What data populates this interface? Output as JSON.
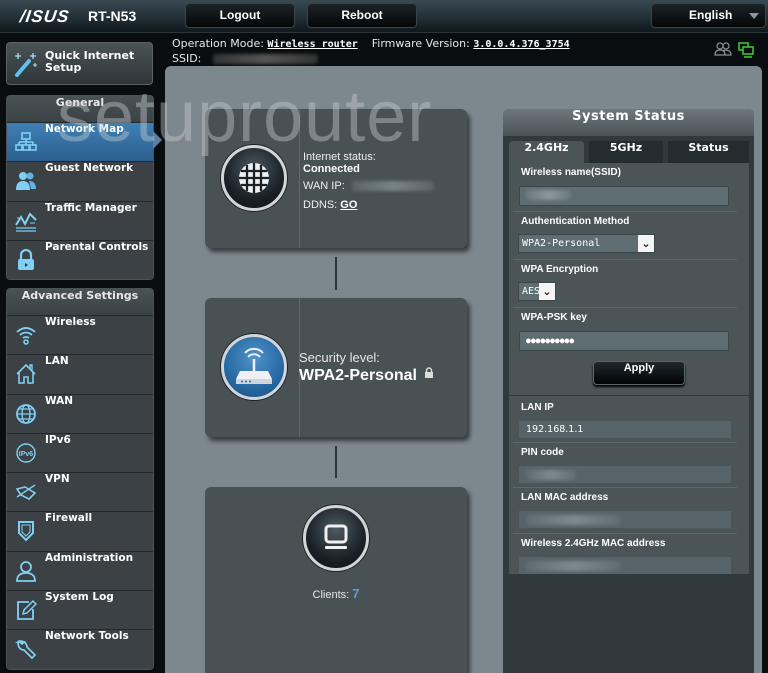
{
  "header": {
    "brand": "/ISUS",
    "model": "RT-N53",
    "logout_label": "Logout",
    "reboot_label": "Reboot",
    "language": "English",
    "operation_mode_label": "Operation Mode:",
    "operation_mode_value": "Wireless router",
    "firmware_label": "Firmware Version:",
    "firmware_value": "3.0.0.4.376_3754",
    "ssid_label": "SSID:",
    "ssid_value": ""
  },
  "watermark": "setuprouter",
  "sidebar": {
    "quick_setup_label": "Quick Internet Setup",
    "general_heading": "General",
    "general_items": [
      {
        "label": "Network Map",
        "icon": "network-map-icon",
        "active": true
      },
      {
        "label": "Guest Network",
        "icon": "guest-network-icon"
      },
      {
        "label": "Traffic Manager",
        "icon": "traffic-manager-icon"
      },
      {
        "label": "Parental Controls",
        "icon": "parental-controls-icon"
      }
    ],
    "advanced_heading": "Advanced Settings",
    "advanced_items": [
      {
        "label": "Wireless",
        "icon": "wireless-icon"
      },
      {
        "label": "LAN",
        "icon": "lan-icon"
      },
      {
        "label": "WAN",
        "icon": "wan-icon"
      },
      {
        "label": "IPv6",
        "icon": "ipv6-icon"
      },
      {
        "label": "VPN",
        "icon": "vpn-icon"
      },
      {
        "label": "Firewall",
        "icon": "firewall-icon"
      },
      {
        "label": "Administration",
        "icon": "administration-icon"
      },
      {
        "label": "System Log",
        "icon": "system-log-icon"
      },
      {
        "label": "Network Tools",
        "icon": "network-tools-icon"
      }
    ]
  },
  "network_map": {
    "internet": {
      "status_label": "Internet status:",
      "status_value": "Connected",
      "wan_ip_label": "WAN IP:",
      "wan_ip_value": "",
      "ddns_label": "DDNS:",
      "ddns_link": "GO"
    },
    "router": {
      "security_label": "Security level:",
      "security_value": "WPA2-Personal"
    },
    "clients": {
      "label": "Clients:",
      "count": "7"
    }
  },
  "system_status": {
    "title": "System Status",
    "tabs": [
      "2.4GHz",
      "5GHz",
      "Status"
    ],
    "active_tab": "2.4GHz",
    "ssid_label": "Wireless name(SSID)",
    "ssid_value": "",
    "auth_label": "Authentication Method",
    "auth_value": "WPA2-Personal",
    "encryption_label": "WPA Encryption",
    "encryption_value": "AES",
    "psk_label": "WPA-PSK key",
    "psk_value": "●●●●●●●●●●",
    "apply_label": "Apply",
    "lan_ip_label": "LAN IP",
    "lan_ip_value": "192.168.1.1",
    "pin_label": "PIN code",
    "pin_value": "",
    "lan_mac_label": "LAN MAC address",
    "lan_mac_value": "",
    "wifi_mac_label": "Wireless 2.4GHz MAC address",
    "wifi_mac_value": ""
  },
  "colors": {
    "accent_blue": "#3f80b6",
    "clients_count": "#5aa0d8",
    "status_green": "#3fbf3f"
  }
}
